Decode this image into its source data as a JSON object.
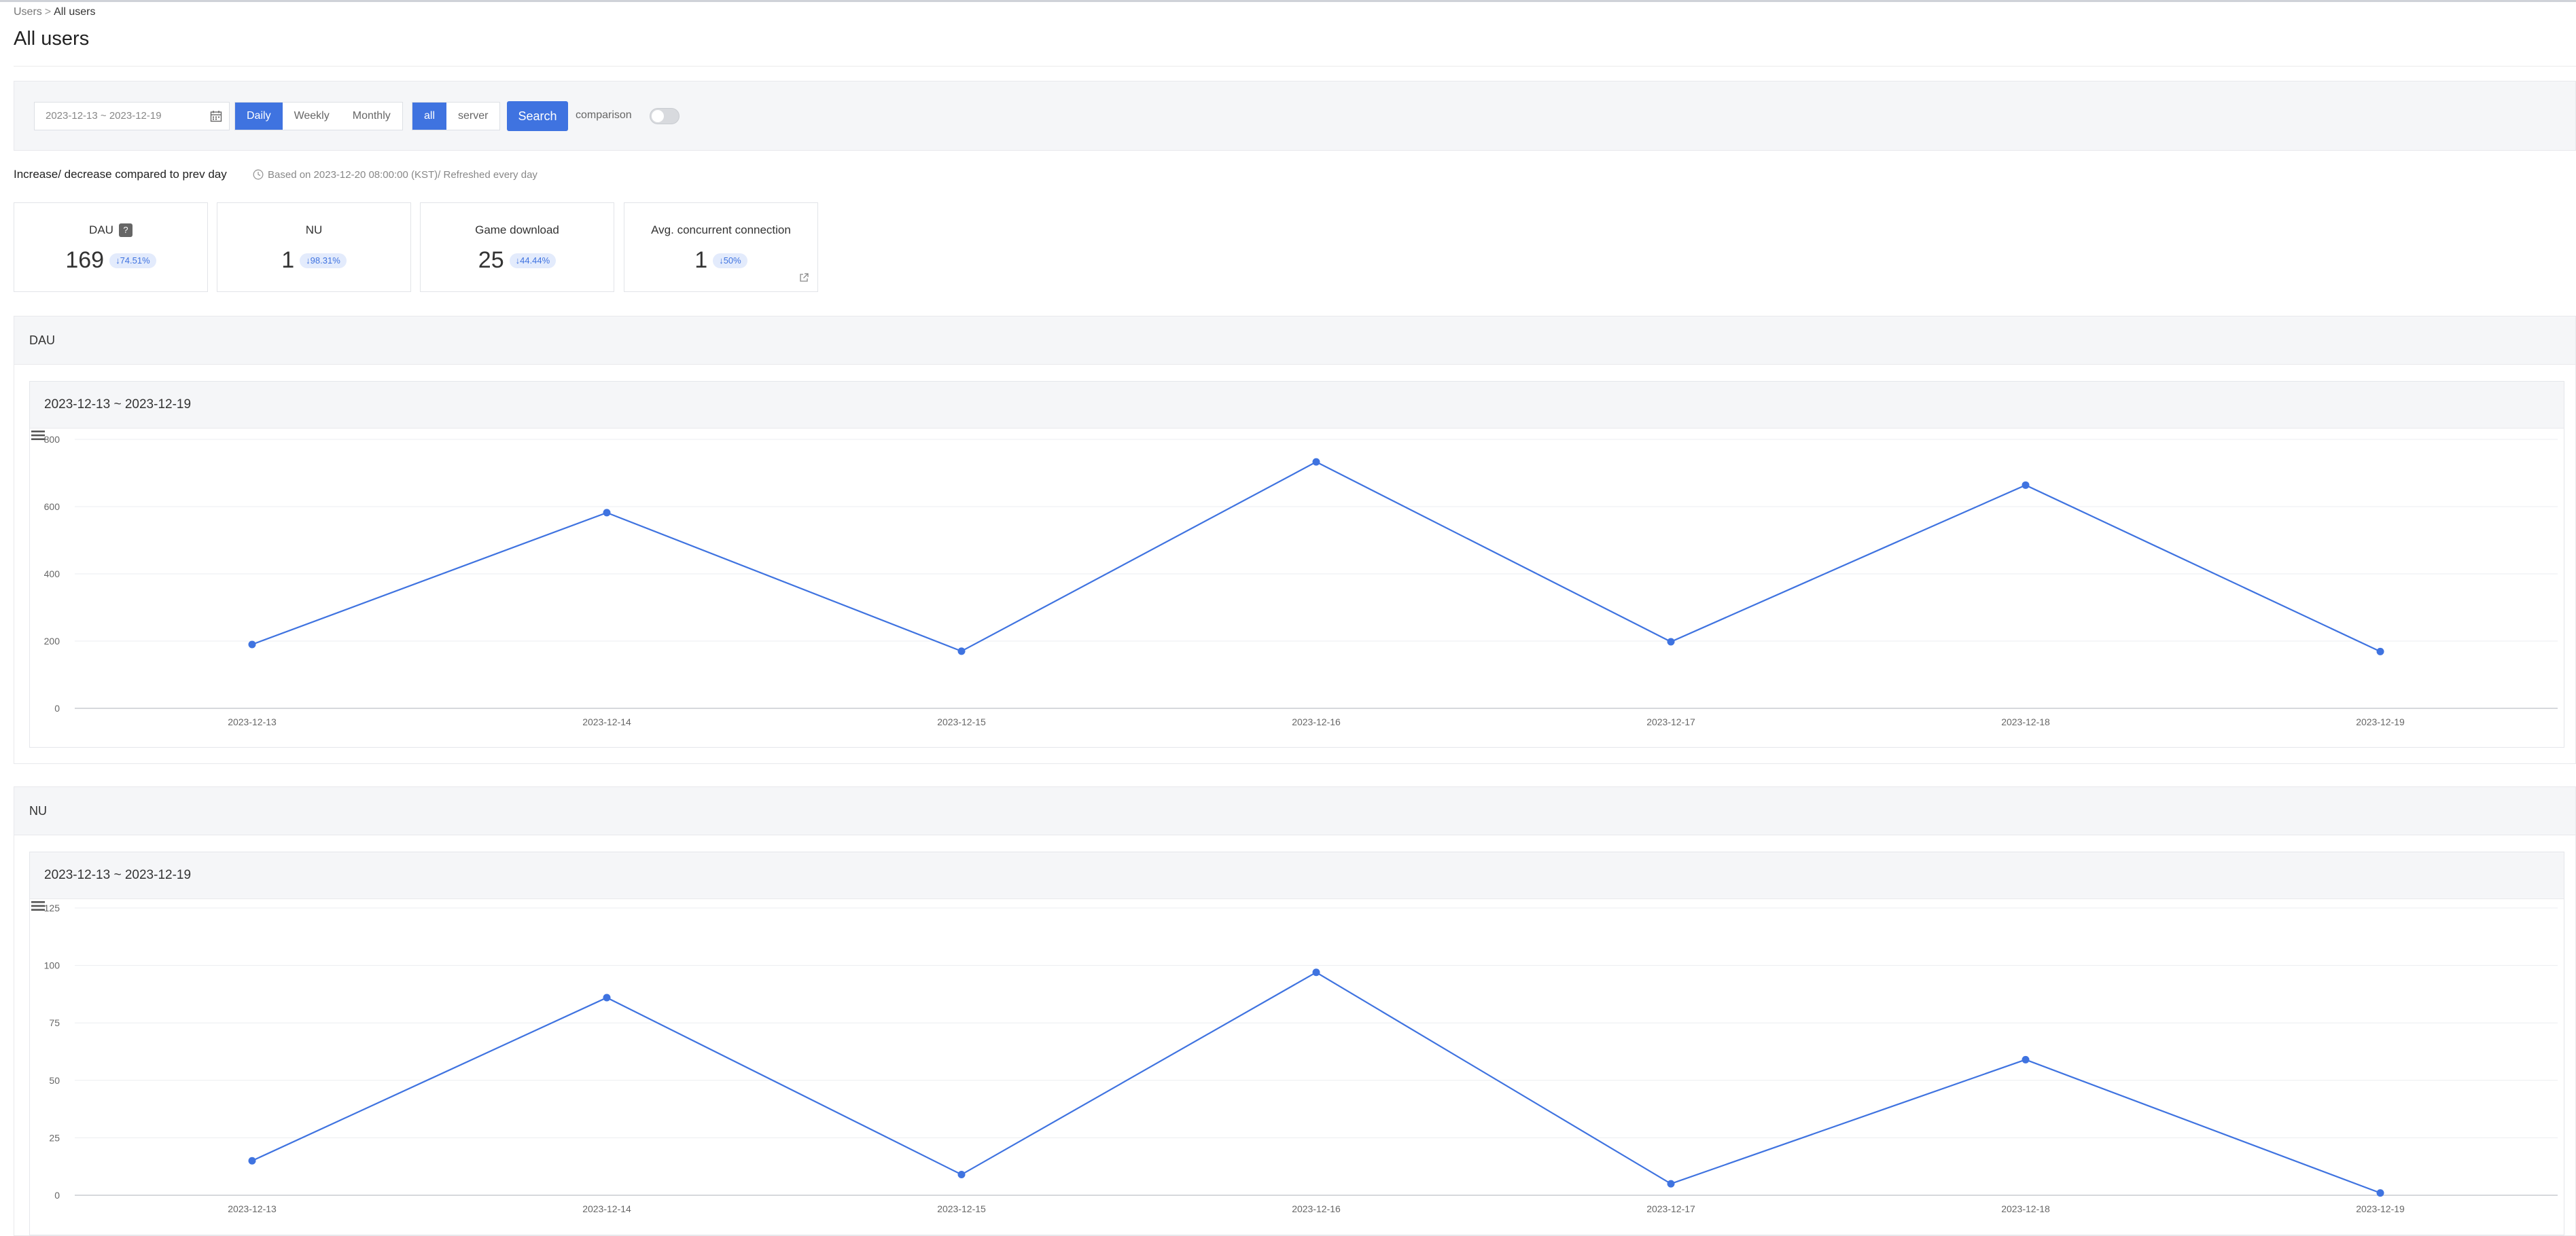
{
  "breadcrumb": {
    "parent": "Users",
    "separator": ">",
    "current": "All users"
  },
  "page": {
    "title": "All users"
  },
  "filters": {
    "date_range": "2023-12-13 ~ 2023-12-19",
    "period_options": [
      "Daily",
      "Weekly",
      "Monthly"
    ],
    "period_selected": "Daily",
    "scope_options": [
      "all",
      "server"
    ],
    "scope_selected": "all",
    "search_label": "Search",
    "comparison_label": "comparison",
    "comparison_on": false
  },
  "change": {
    "title": "Increase/ decrease compared to prev day",
    "based_on": "Based on 2023-12-20 08:00:00 (KST)/ Refreshed every day"
  },
  "cards": [
    {
      "label": "DAU",
      "help": "?",
      "value": "169",
      "change": "74.51%"
    },
    {
      "label": "NU",
      "value": "1",
      "change": "98.31%"
    },
    {
      "label": "Game download",
      "value": "25",
      "change": "44.44%"
    },
    {
      "label": "Avg. concurrent connection",
      "value": "1",
      "change": "50%"
    }
  ],
  "accent_color": "#3f73e0",
  "sections": [
    {
      "title": "DAU",
      "panel_title": "2023-12-13 ~ 2023-12-19"
    },
    {
      "title": "NU",
      "panel_title": "2023-12-13 ~ 2023-12-19"
    }
  ],
  "chart_data": [
    {
      "type": "line",
      "x": [
        "2023-12-13",
        "2023-12-14",
        "2023-12-15",
        "2023-12-16",
        "2023-12-17",
        "2023-12-18",
        "2023-12-19"
      ],
      "series": [
        {
          "values": [
            190,
            582,
            170,
            733,
            198,
            664,
            169
          ]
        }
      ],
      "ylim": [
        0,
        800
      ],
      "yticks": [
        0,
        200,
        400,
        600,
        800
      ],
      "grid": true,
      "color": "#3f73e0"
    },
    {
      "type": "line",
      "x": [
        "2023-12-13",
        "2023-12-14",
        "2023-12-15",
        "2023-12-16",
        "2023-12-17",
        "2023-12-18",
        "2023-12-19"
      ],
      "series": [
        {
          "values": [
            15,
            86,
            9,
            97,
            5,
            59,
            1
          ]
        }
      ],
      "ylim": [
        0,
        125
      ],
      "yticks": [
        0,
        25,
        50,
        75,
        100,
        125
      ],
      "grid": true,
      "color": "#3f73e0"
    }
  ]
}
